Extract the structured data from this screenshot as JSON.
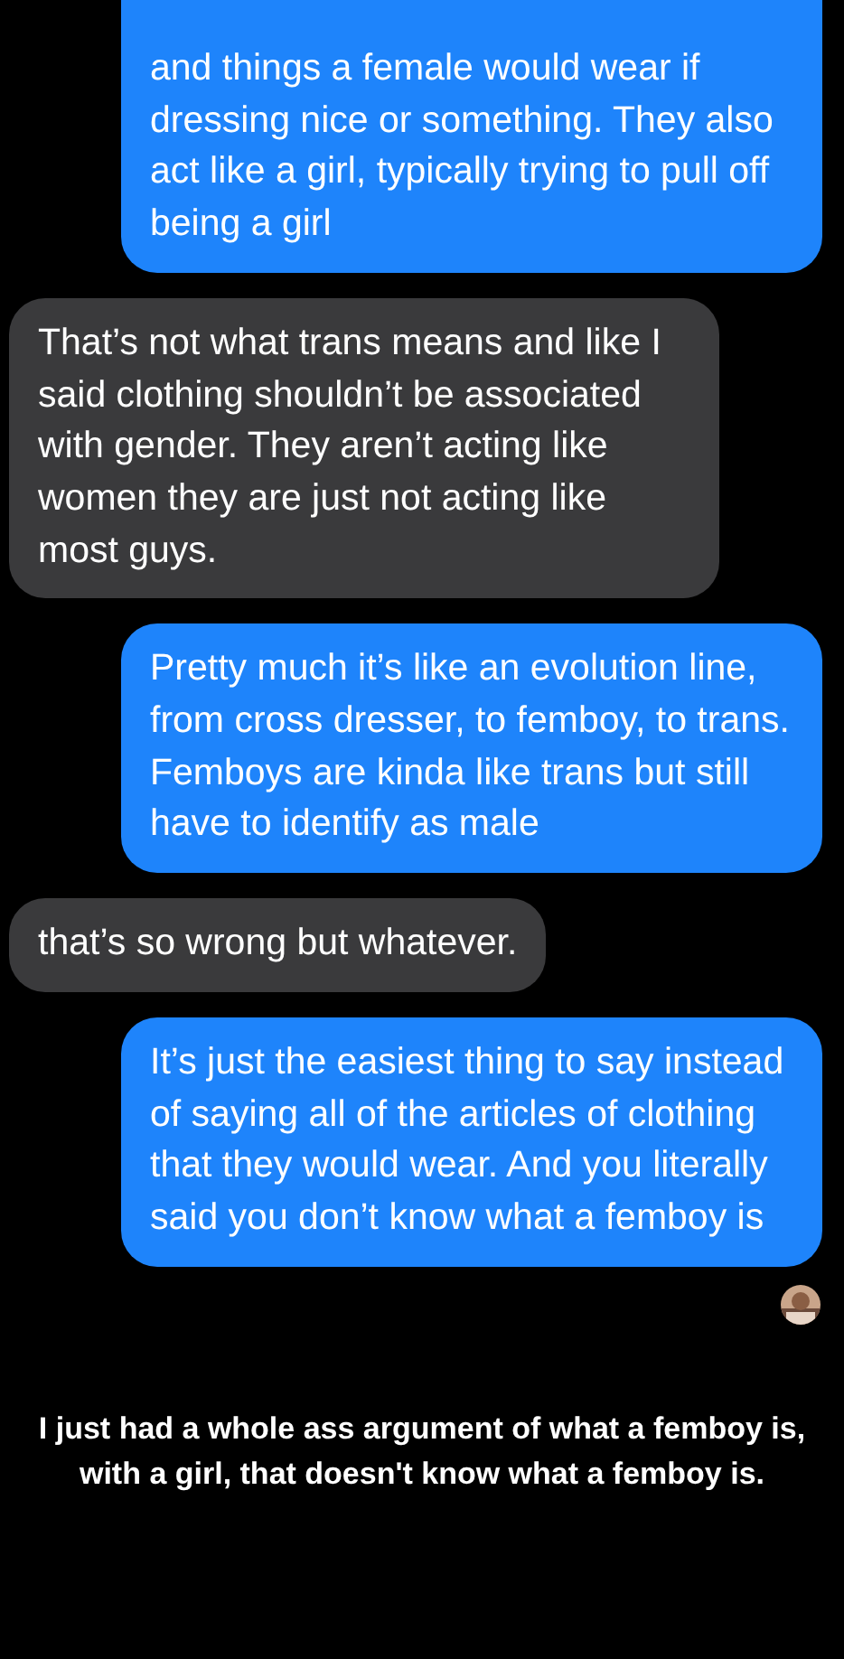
{
  "messages": [
    {
      "kind": "sent",
      "text": "and things a female would wear if dressing nice or something. They also act like a girl, typically trying to pull off being a girl",
      "cut_top": true
    },
    {
      "kind": "received",
      "text": "That’s not what trans means and like I said clothing shouldn’t be associated with gender. They aren’t acting like women they are just not acting like most guys.",
      "cut_top": false
    },
    {
      "kind": "sent",
      "text": "Pretty much it’s like an evolution line, from cross dresser, to femboy, to trans. Femboys are kinda like trans but still have to identify as male",
      "cut_top": false
    },
    {
      "kind": "received",
      "text": "that’s so wrong but whatever.",
      "cut_top": false
    },
    {
      "kind": "sent",
      "text": "It’s just the easiest thing to say instead of saying all of the articles of clothing that they would wear. And you literally said you don’t know what a femboy is",
      "cut_top": false
    }
  ],
  "caption": "I just had a whole ass argument of what a femboy is, with a girl, that doesn't know what a femboy is."
}
